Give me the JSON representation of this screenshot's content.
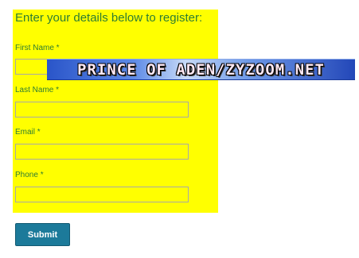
{
  "form": {
    "intro": "Enter your details below to register:",
    "fields": [
      {
        "label": "First Name *",
        "value": ""
      },
      {
        "label": "Last Name *",
        "value": ""
      },
      {
        "label": "Email *",
        "value": ""
      },
      {
        "label": "Phone *",
        "value": ""
      }
    ],
    "submit_label": "Submit"
  },
  "watermark": {
    "text": "PRINCE OF ADEN/ZYZOOM.NET"
  },
  "colors": {
    "panel_background": "#ffff00",
    "label_text": "#2e7d32",
    "submit_background": "#1c7a9a"
  }
}
